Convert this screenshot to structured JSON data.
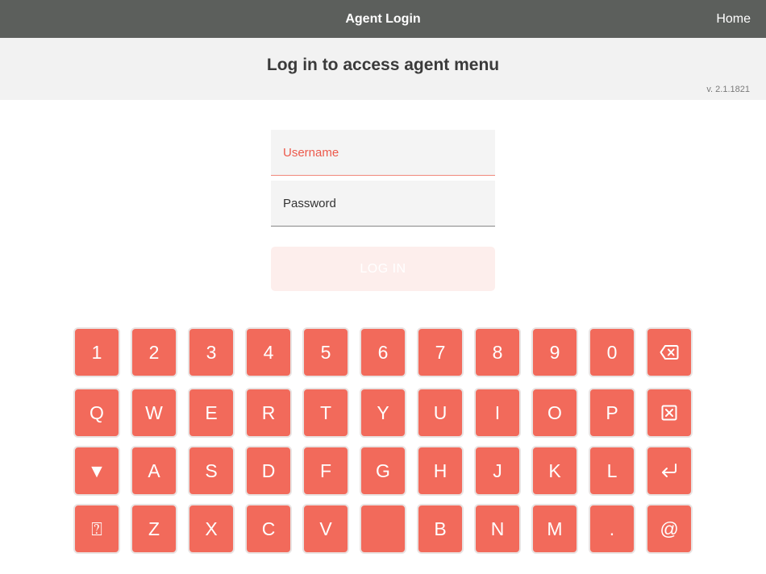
{
  "topbar": {
    "title": "Agent Login",
    "home_label": "Home"
  },
  "subheader": {
    "heading": "Log in to access agent menu",
    "version": "v. 2.1.1821"
  },
  "form": {
    "username_placeholder": "Username",
    "username_value": "",
    "password_placeholder": "Password",
    "password_value": "",
    "login_label": "LOG IN"
  },
  "colors": {
    "topbar": "#5c5f5c",
    "accent": "#f26a5b",
    "login_disabled": "#fdeeec"
  },
  "keyboard": {
    "rows": [
      [
        {
          "label": "1"
        },
        {
          "label": "2"
        },
        {
          "label": "3"
        },
        {
          "label": "4"
        },
        {
          "label": "5"
        },
        {
          "label": "6"
        },
        {
          "label": "7"
        },
        {
          "label": "8"
        },
        {
          "label": "9"
        },
        {
          "label": "0"
        },
        {
          "label": "",
          "icon": "backspace-icon"
        }
      ],
      [
        {
          "label": "Q"
        },
        {
          "label": "W"
        },
        {
          "label": "E"
        },
        {
          "label": "R"
        },
        {
          "label": "T"
        },
        {
          "label": "Y"
        },
        {
          "label": "U"
        },
        {
          "label": "I"
        },
        {
          "label": "O"
        },
        {
          "label": "P"
        },
        {
          "label": "",
          "icon": "clear-icon"
        }
      ],
      [
        {
          "label": "▼",
          "icon": "hide-keyboard-icon"
        },
        {
          "label": "A"
        },
        {
          "label": "S"
        },
        {
          "label": "D"
        },
        {
          "label": "F"
        },
        {
          "label": "G"
        },
        {
          "label": "H"
        },
        {
          "label": "J"
        },
        {
          "label": "K"
        },
        {
          "label": "L"
        },
        {
          "label": "",
          "icon": "enter-icon"
        }
      ],
      [
        {
          "label": "⍰",
          "icon": "unknown-glyph-icon"
        },
        {
          "label": "Z"
        },
        {
          "label": "X"
        },
        {
          "label": "C"
        },
        {
          "label": "V"
        },
        {
          "label": "",
          "icon": "space-key"
        },
        {
          "label": "B"
        },
        {
          "label": "N"
        },
        {
          "label": "M"
        },
        {
          "label": "."
        },
        {
          "label": "@"
        }
      ]
    ]
  }
}
